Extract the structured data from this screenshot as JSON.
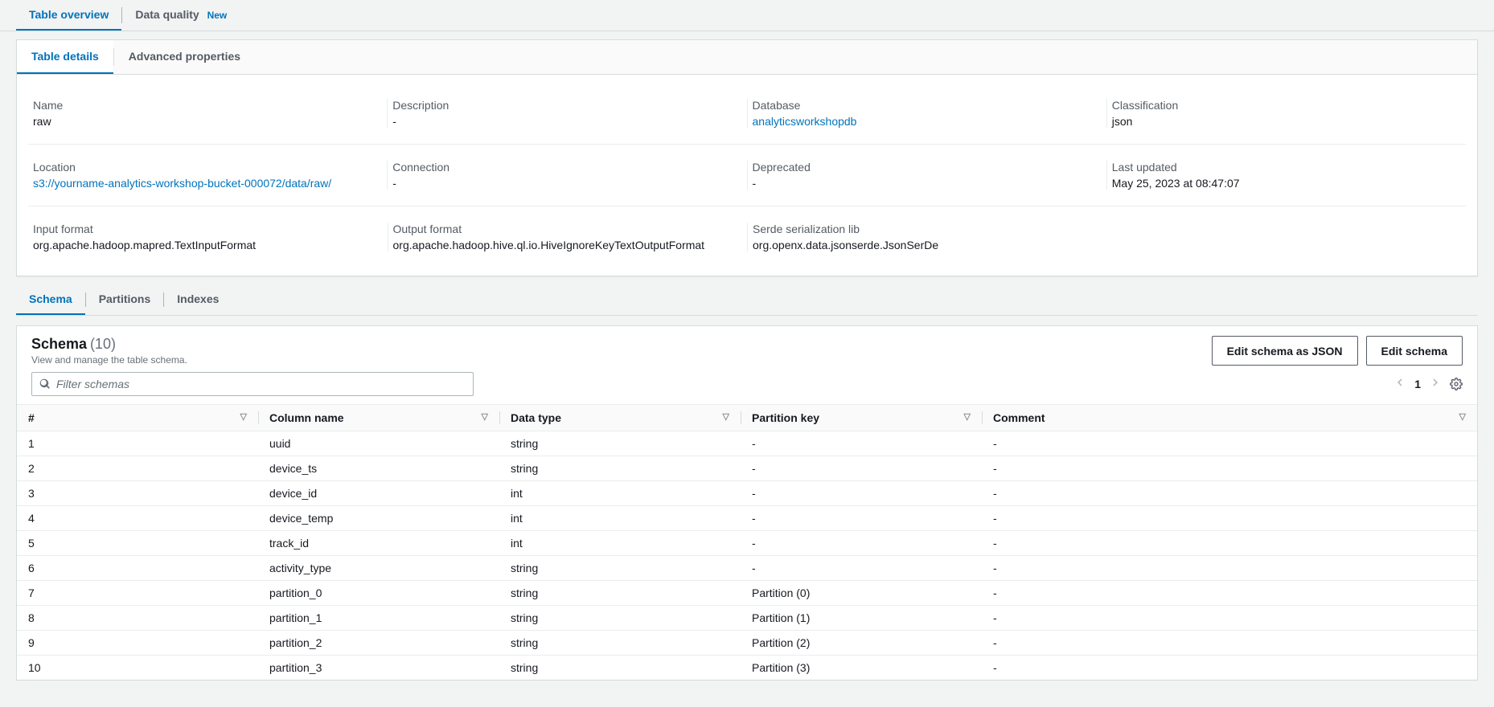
{
  "topTabs": {
    "overview": "Table overview",
    "quality": "Data quality",
    "newBadge": "New"
  },
  "detailTabs": {
    "details": "Table details",
    "advanced": "Advanced properties"
  },
  "details": {
    "name": {
      "label": "Name",
      "value": "raw"
    },
    "description": {
      "label": "Description",
      "value": "-"
    },
    "database": {
      "label": "Database",
      "value": "analyticsworkshopdb"
    },
    "classification": {
      "label": "Classification",
      "value": "json"
    },
    "location": {
      "label": "Location",
      "value": "s3://yourname-analytics-workshop-bucket-000072/data/raw/"
    },
    "connection": {
      "label": "Connection",
      "value": "-"
    },
    "deprecated": {
      "label": "Deprecated",
      "value": "-"
    },
    "lastUpdated": {
      "label": "Last updated",
      "value": "May 25, 2023 at 08:47:07"
    },
    "inputFormat": {
      "label": "Input format",
      "value": "org.apache.hadoop.mapred.TextInputFormat"
    },
    "outputFormat": {
      "label": "Output format",
      "value": "org.apache.hadoop.hive.ql.io.HiveIgnoreKeyTextOutputFormat"
    },
    "serde": {
      "label": "Serde serialization lib",
      "value": "org.openx.data.jsonserde.JsonSerDe"
    }
  },
  "schemaTabs": {
    "schema": "Schema",
    "partitions": "Partitions",
    "indexes": "Indexes"
  },
  "schema": {
    "title": "Schema",
    "count": "(10)",
    "subtitle": "View and manage the table schema.",
    "editJsonBtn": "Edit schema as JSON",
    "editBtn": "Edit schema",
    "searchPlaceholder": "Filter schemas",
    "page": "1",
    "headers": {
      "num": "#",
      "name": "Column name",
      "type": "Data type",
      "partition": "Partition key",
      "comment": "Comment"
    },
    "rows": [
      {
        "num": "1",
        "name": "uuid",
        "type": "string",
        "partition": "-",
        "comment": "-"
      },
      {
        "num": "2",
        "name": "device_ts",
        "type": "string",
        "partition": "-",
        "comment": "-"
      },
      {
        "num": "3",
        "name": "device_id",
        "type": "int",
        "partition": "-",
        "comment": "-"
      },
      {
        "num": "4",
        "name": "device_temp",
        "type": "int",
        "partition": "-",
        "comment": "-"
      },
      {
        "num": "5",
        "name": "track_id",
        "type": "int",
        "partition": "-",
        "comment": "-"
      },
      {
        "num": "6",
        "name": "activity_type",
        "type": "string",
        "partition": "-",
        "comment": "-"
      },
      {
        "num": "7",
        "name": "partition_0",
        "type": "string",
        "partition": "Partition (0)",
        "comment": "-"
      },
      {
        "num": "8",
        "name": "partition_1",
        "type": "string",
        "partition": "Partition (1)",
        "comment": "-"
      },
      {
        "num": "9",
        "name": "partition_2",
        "type": "string",
        "partition": "Partition (2)",
        "comment": "-"
      },
      {
        "num": "10",
        "name": "partition_3",
        "type": "string",
        "partition": "Partition (3)",
        "comment": "-"
      }
    ]
  }
}
